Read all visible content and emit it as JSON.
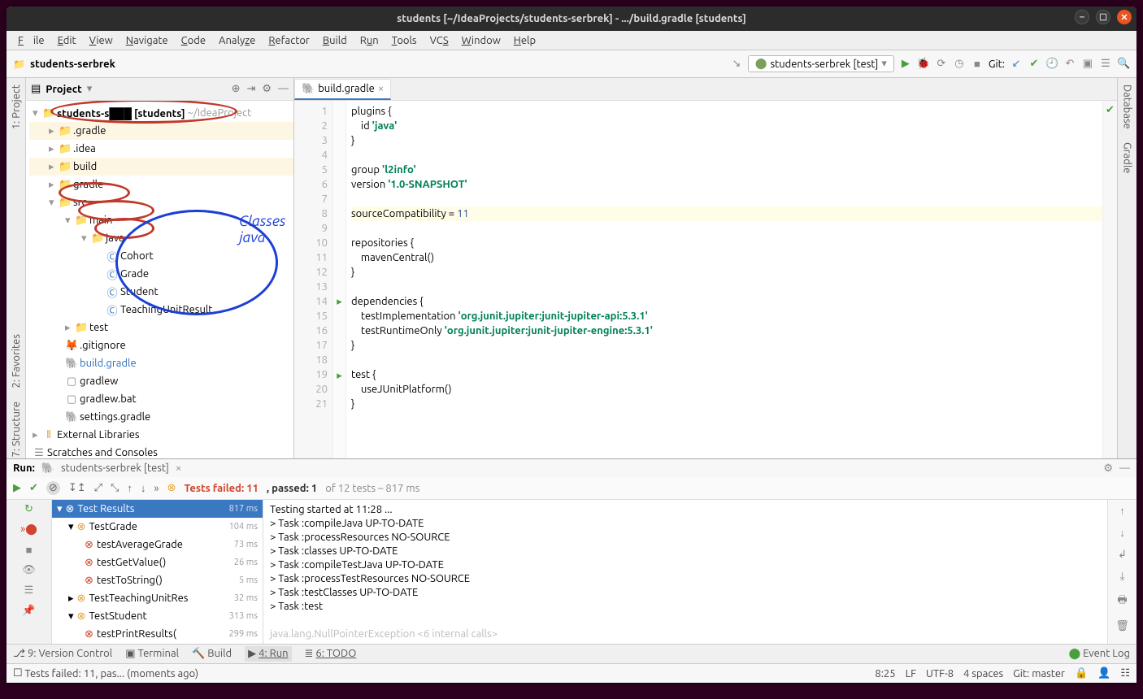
{
  "titlebar": "students [~/IdeaProjects/students-serbrek] - .../build.gradle [students]",
  "menu": [
    "File",
    "Edit",
    "View",
    "Navigate",
    "Code",
    "Analyze",
    "Refactor",
    "Build",
    "Run",
    "Tools",
    "VCS",
    "Window",
    "Help"
  ],
  "breadcrumb": "students-serbrek",
  "run_config": "students-serbrek [test]",
  "git_label": "Git:",
  "project_header": "Project",
  "annot_classes": "Classes java",
  "tree": {
    "root": "students-s███ [students]",
    "root_hint": "~/IdeaProject",
    "gradle_dot": ".gradle",
    "idea": ".idea",
    "build": "build",
    "gradle": "gradle",
    "src": "src",
    "main": "main",
    "java": "java",
    "cohort": "Cohort",
    "grade": "Grade",
    "student": "Student",
    "tur": "TeachingUnitResult",
    "test": "test",
    "gitignore": ".gitignore",
    "buildgradle": "build.gradle",
    "gradlew": "gradlew",
    "gradlewbat": "gradlew.bat",
    "settings": "settings.gradle",
    "extlib": "External Libraries",
    "scratches": "Scratches and Consoles"
  },
  "editor_tab": "build.gradle",
  "code": {
    "l1": "plugins {",
    "l2": "    id ",
    "l2s": "'java'",
    "l3": "}",
    "l5a": "group ",
    "l5s": "'l2info'",
    "l6a": "version ",
    "l6s": "'1.0-SNAPSHOT'",
    "l8a": "sourceCompatibility = ",
    "l8n": "11",
    "l10": "repositories {",
    "l11": "    mavenCentral()",
    "l12": "}",
    "l14": "dependencies {",
    "l15a": "    testImplementation ",
    "l15s": "'org.junit.jupiter:junit-jupiter-api:5.3.1'",
    "l16a": "    testRuntimeOnly ",
    "l16s": "'org.junit.jupiter:junit-jupiter-engine:5.3.1'",
    "l17": "}",
    "l19": "test {",
    "l20": "    useJUnitPlatform()",
    "l21": "}"
  },
  "run_tab_label": "Run:",
  "run_tab_name": "students-serbrek [test]",
  "test_summary_fail": "Tests failed: 11",
  "test_summary_pass": ", passed: 1",
  "test_summary_rest": " of 12 tests – 817 ms",
  "test_tree": {
    "root": "Test Results",
    "root_t": "817 ms",
    "tg": "TestGrade",
    "tg_t": "104 ms",
    "tavg": "testAverageGrade",
    "tavg_t": "73 ms",
    "tgv": "testGetValue()",
    "tgv_t": "26 ms",
    "tts": "testToString()",
    "tts_t": "5 ms",
    "ttur": "TestTeachingUnitRes",
    "ttur_t": "32 ms",
    "tstu": "TestStudent",
    "tstu_t": "313 ms",
    "tpr": "testPrintResults(",
    "tpr_t": "299 ms"
  },
  "console": {
    "l1": "Testing started at 11:28 ...",
    "l2": "> Task :compileJava UP-TO-DATE",
    "l3": "> Task :processResources NO-SOURCE",
    "l4": "> Task :classes UP-TO-DATE",
    "l5": "> Task :compileTestJava UP-TO-DATE",
    "l6": "> Task :processTestResources NO-SOURCE",
    "l7": "> Task :testClasses UP-TO-DATE",
    "l8": "> Task :test",
    "l10": "java.lang.NullPointerException <6 internal calls>"
  },
  "bottom": {
    "vc": "9: Version Control",
    "term": "Terminal",
    "build": "Build",
    "run": "4: Run",
    "todo": "6: TODO",
    "eventlog": "Event Log"
  },
  "status_msg": "Tests failed: 11, pas... (moments ago)",
  "status_right": {
    "pos": "8:25",
    "lf": "LF",
    "enc": "UTF-8",
    "indent": "4 spaces",
    "git": "Git: master"
  },
  "side_tabs": {
    "project": "1: Project",
    "structure": "7: Structure",
    "fav": "2: Favorites",
    "db": "Database",
    "gradle": "Gradle"
  }
}
